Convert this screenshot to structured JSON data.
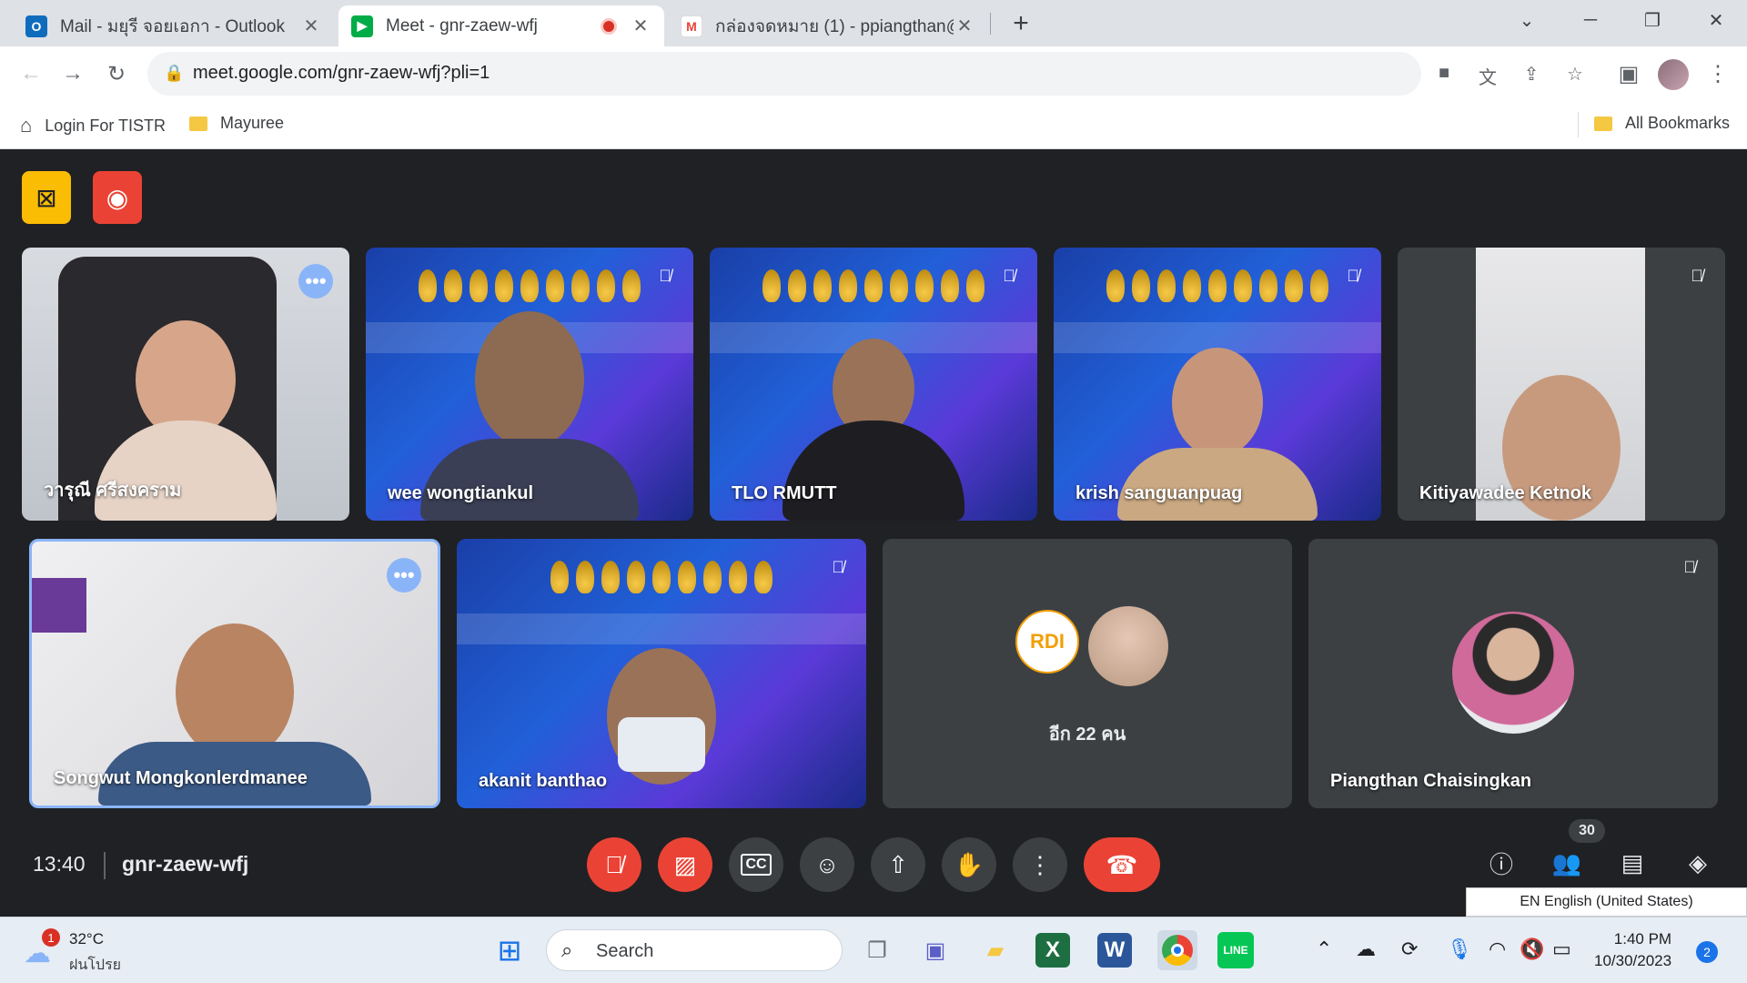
{
  "browser": {
    "tabs": [
      {
        "title": "Mail - มยุรี จอยเอกา - Outlook",
        "icon": "outlook-icon",
        "color": "#0f6cbd"
      },
      {
        "title": "Meet - gnr-zaew-wfj",
        "icon": "meet-icon",
        "color": "#00ac47"
      },
      {
        "title": "กล่องจดหมาย (1) - ppiangthan@g",
        "icon": "gmail-icon",
        "color": "#ea4335"
      }
    ],
    "new_tab": "+",
    "url": "meet.google.com/gnr-zaew-wfj?pli=1",
    "bookmarks": [
      {
        "label": "Login For TISTR",
        "icon": "home-icon"
      },
      {
        "label": "Mayuree",
        "icon": "folder-icon"
      }
    ],
    "all_bookmarks": "All Bookmarks"
  },
  "meet": {
    "tiles_row1": [
      {
        "name": "วารุณี ศรีสงคราม"
      },
      {
        "name": "wee wongtiankul"
      },
      {
        "name": "TLO RMUTT"
      },
      {
        "name": "krish sanguanpuag"
      },
      {
        "name": "Kitiyawadee Ketnok"
      }
    ],
    "tiles_row2": [
      {
        "name": "Songwut Mongkonlerdmanee"
      },
      {
        "name": "akanit banthao"
      },
      {
        "name": "อีก 22 คน"
      },
      {
        "name": "Piangthan Chaisingkan"
      }
    ],
    "clock": "13:40",
    "meeting_code": "gnr-zaew-wfj",
    "participant_count": "30",
    "language": "EN English (United States)"
  },
  "taskbar": {
    "weather_temp": "32°C",
    "weather_desc": "ฝนโปรย",
    "weather_badge": "1",
    "search_placeholder": "Search",
    "time": "1:40 PM",
    "date": "10/30/2023",
    "notif_count": "2"
  }
}
